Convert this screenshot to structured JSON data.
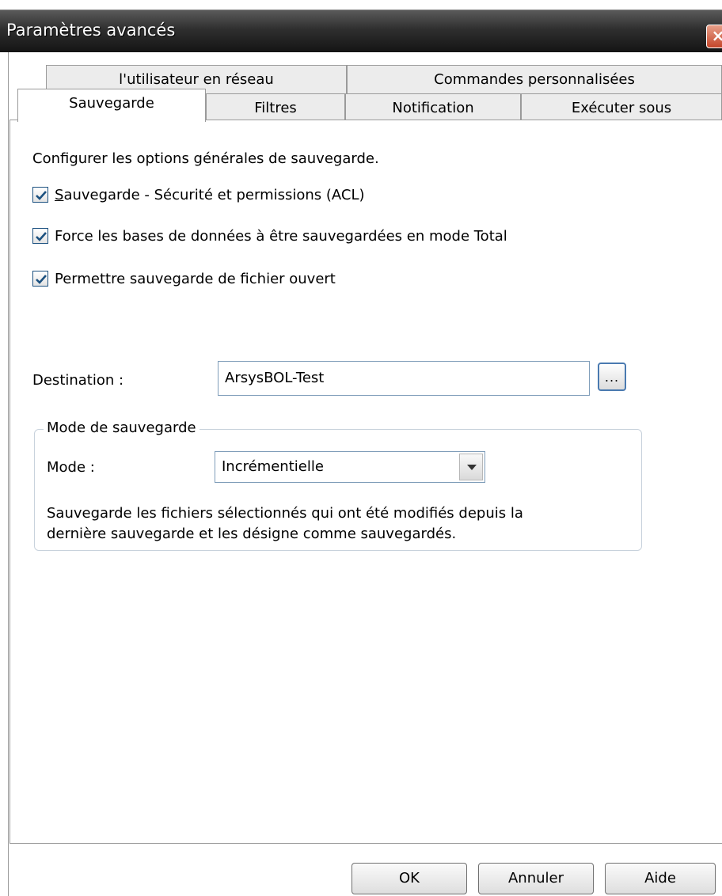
{
  "window": {
    "title": "Paramètres avancés",
    "close_label": "×"
  },
  "tabs_row1": [
    {
      "label": "l'utilisateur en réseau"
    },
    {
      "label": "Commandes personnalisées"
    }
  ],
  "tabs_row2": [
    {
      "label": "Sauvegarde",
      "active": true
    },
    {
      "label": "Filtres"
    },
    {
      "label": "Notification"
    },
    {
      "label": "Exécuter sous"
    }
  ],
  "panel": {
    "description": "Configurer les options générales de sauvegarde.",
    "checkboxes": [
      {
        "prefix": "",
        "accel": "S",
        "rest": "auvegarde - Sécurité et permissions (ACL)",
        "checked": true
      },
      {
        "prefix": "",
        "accel": "",
        "rest": "Force les bases de données à être sauvegardées en mode Total",
        "checked": true
      },
      {
        "prefix": "",
        "accel": "",
        "rest": "Permettre sauvegarde de fichier ouvert",
        "checked": true
      }
    ],
    "destination": {
      "label": "Destination :",
      "value": "ArsysBOL-Test",
      "browse_label": "..."
    },
    "mode_group": {
      "legend": "Mode de sauvegarde",
      "mode_label": "Mode :",
      "mode_value": "Incrémentielle",
      "description_line1": "Sauvegarde les fichiers sélectionnés qui ont été modifiés depuis la",
      "description_line2": "dernière sauvegarde et les désigne comme sauvegardés."
    }
  },
  "buttons": {
    "ok": "OK",
    "cancel": "Annuler",
    "help": "Aide"
  },
  "colors": {
    "titlebar": "#2f2f2f",
    "checkmark": "#1c5180",
    "accent_border": "#4a7ab0"
  }
}
